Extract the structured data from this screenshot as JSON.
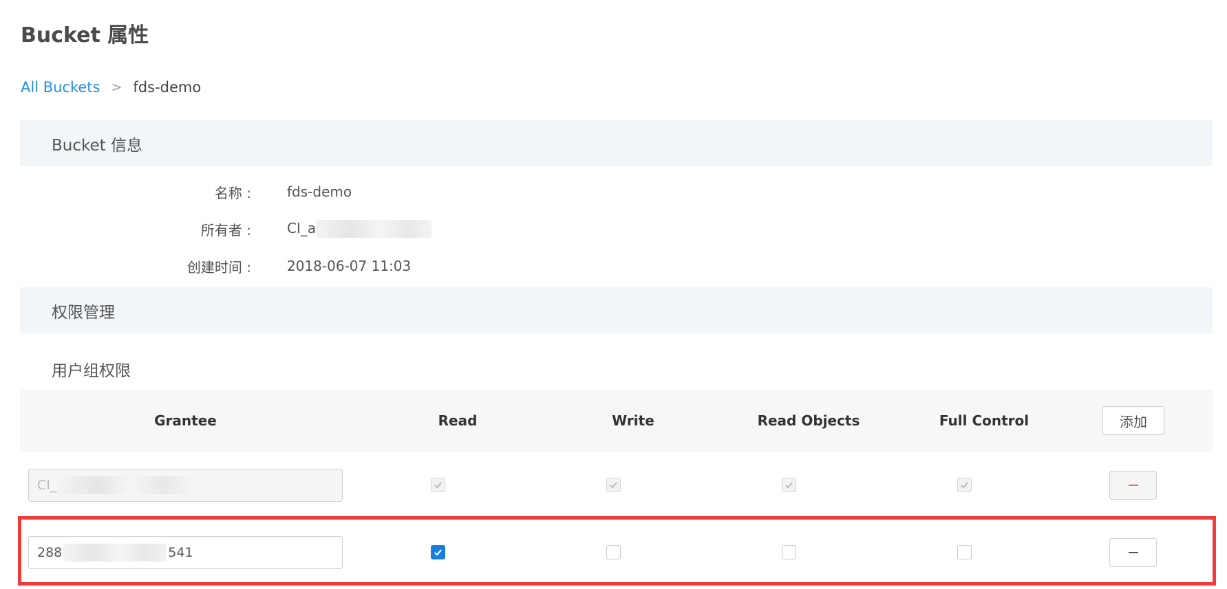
{
  "page": {
    "title": "Bucket 属性"
  },
  "breadcrumb": {
    "root": "All Buckets",
    "separator": ">",
    "current": "fds-demo"
  },
  "bucket_info": {
    "header": "Bucket 信息",
    "rows": [
      {
        "label": "名称 :",
        "value": "fds-demo"
      },
      {
        "label": "所有者 :",
        "value": "CI_a"
      },
      {
        "label": "创建时间 :",
        "value": "2018-06-07 11:03"
      }
    ]
  },
  "permissions": {
    "header": "权限管理",
    "group_title": "用户组权限",
    "columns": [
      "Grantee",
      "Read",
      "Write",
      "Read Objects",
      "Full Control"
    ],
    "add_label": "添加",
    "rows": [
      {
        "grantee_prefix": "CI_",
        "grantee_suffix": "",
        "disabled": true,
        "read": true,
        "write": true,
        "read_objects": true,
        "full_control": true
      },
      {
        "grantee_prefix": "288",
        "grantee_suffix": "541",
        "disabled": false,
        "read": true,
        "write": false,
        "read_objects": false,
        "full_control": false
      }
    ]
  },
  "colors": {
    "accent": "#1f8ee6",
    "highlight": "#ee3b3b",
    "section_bg": "#f2f6f9",
    "checked": "#1a7de0"
  }
}
